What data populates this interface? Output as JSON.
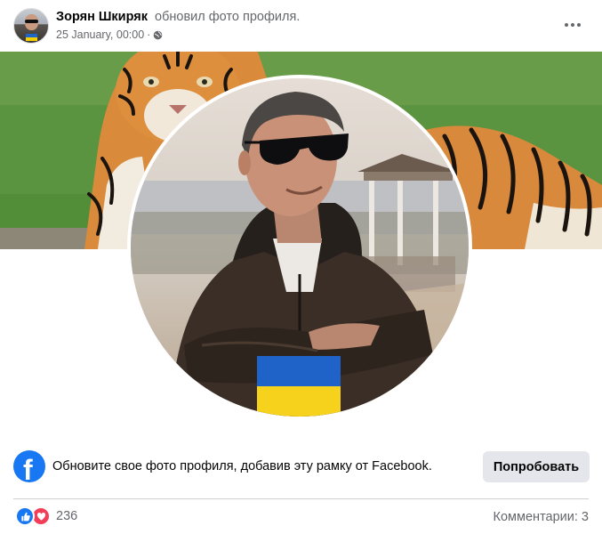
{
  "post": {
    "author": "Зорян Шкиряк",
    "action": "обновил фото профиля.",
    "date": "25 January, 00:00",
    "separator": "·",
    "privacy_icon": "globe-icon",
    "more_icon": "more-options-icon"
  },
  "images": {
    "cover": "tiger-cover-photo",
    "profile": "profile-photo-man-sunglasses-ukraine-flag"
  },
  "promo": {
    "icon": "facebook-logo-icon",
    "text": "Обновите свое фото профиля, добавив эту рамку от Facebook.",
    "button_label": "Попробовать"
  },
  "footer": {
    "reaction_icons": [
      "like-icon",
      "love-icon"
    ],
    "reaction_count": "236",
    "comments_label": "Комментарии: 3"
  },
  "colors": {
    "facebook_blue": "#1877f2",
    "love_red": "#f33e58",
    "flag_blue": "#0057b7",
    "flag_yellow": "#ffd700",
    "secondary_text": "#65676b",
    "button_bg": "#e4e6eb"
  }
}
